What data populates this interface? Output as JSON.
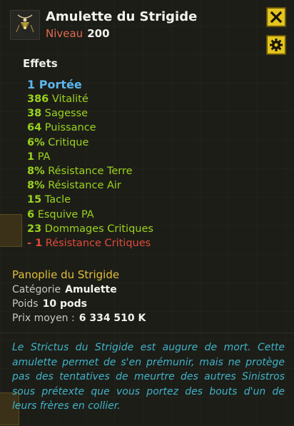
{
  "item": {
    "name": "Amulette du Strigide",
    "level_label": "Niveau",
    "level_value": "200",
    "icon": "amulet-icon"
  },
  "buttons": {
    "close_icon": "close-icon",
    "settings_icon": "gear-icon"
  },
  "effects_title": "Effets",
  "effects": [
    {
      "value": "1",
      "label": "Portée",
      "style": "range"
    },
    {
      "value": "386",
      "label": "Vitalité",
      "style": "positive"
    },
    {
      "value": "38",
      "label": "Sagesse",
      "style": "positive"
    },
    {
      "value": "64",
      "label": "Puissance",
      "style": "positive"
    },
    {
      "value": "6%",
      "label": "Critique",
      "style": "positive"
    },
    {
      "value": "1",
      "label": "PA",
      "style": "positive"
    },
    {
      "value": "8%",
      "label": "Résistance Terre",
      "style": "positive"
    },
    {
      "value": "8%",
      "label": "Résistance Air",
      "style": "positive"
    },
    {
      "value": "15",
      "label": "Tacle",
      "style": "positive"
    },
    {
      "value": "6",
      "label": "Esquive PA",
      "style": "positive"
    },
    {
      "value": "23",
      "label": "Dommages Critiques",
      "style": "positive"
    },
    {
      "value": "- 1",
      "label": "Résistance Critiques",
      "style": "negative"
    }
  ],
  "set": {
    "name": "Panoplie du Strigide"
  },
  "info": {
    "category_label": "Catégorie",
    "category_value": "Amulette",
    "weight_label": "Poids",
    "weight_value": "10 pods",
    "price_label": "Prix moyen :",
    "price_value": "6 334 510 K"
  },
  "description": "Le Strictus du Strigide est augure de mort. Cette amulette permet de s'en prémunir, mais ne protège pas des tentatives de meurtre des autres Sinistros sous prétexte que vous portez des bouts d'un de leurs frères en collier.",
  "colors": {
    "accent_yellow": "#e3c51e",
    "effect_green": "#9ad31c",
    "effect_blue": "#5cb7ee",
    "effect_red": "#e04a3a",
    "set_gold": "#e0bf3a",
    "description_cyan": "#3fb3c7"
  }
}
